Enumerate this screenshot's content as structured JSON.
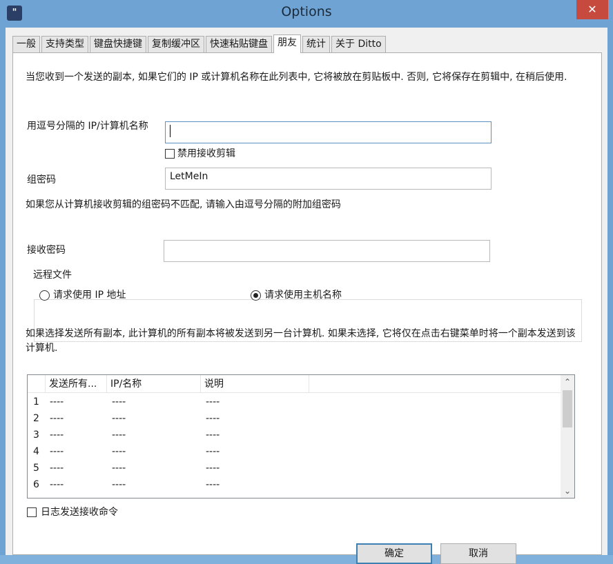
{
  "window": {
    "title": "Options",
    "icon": "ditto-app-icon",
    "close_glyph": "✕"
  },
  "tabs": [
    {
      "label": "一般",
      "active": false
    },
    {
      "label": "支持类型",
      "active": false
    },
    {
      "label": "键盘快捷键",
      "active": false
    },
    {
      "label": "复制缓冲区",
      "active": false
    },
    {
      "label": "快速粘贴键盘",
      "active": false
    },
    {
      "label": "朋友",
      "active": true
    },
    {
      "label": "统计",
      "active": false
    },
    {
      "label": "关于 Ditto",
      "active": false
    }
  ],
  "friends": {
    "intro": "当您收到一个发送的副本, 如果它们的 IP 或计算机名称在此列表中, 它将被放在剪贴板中. 否则, 它将保存在剪辑中, 在稍后使用.",
    "ip_label": "用逗号分隔的 IP/计算机名称",
    "ip_value": "",
    "disable_receive_label": "禁用接收剪辑",
    "disable_receive_checked": false,
    "group_password_label": "组密码",
    "group_password_value": "LetMeIn",
    "extra_password_note": "如果您从计算机接收剪辑的组密码不匹配, 请输入由逗号分隔的附加组密码",
    "receive_password_label": "接收密码",
    "receive_password_value": "",
    "remote_files": {
      "title": "远程文件",
      "option_ip": "请求使用 IP 地址",
      "option_host": "请求使用主机名称",
      "selected": "host"
    },
    "send_all_note": "如果选择发送所有副本, 此计算机的所有副本将被发送到另一台计算机. 如果未选择, 它将仅在点击右键菜单时将一个副本发送到该计算机.",
    "table": {
      "columns": [
        "发送所有...",
        "IP/名称",
        "说明"
      ],
      "rows": [
        {
          "num": "1",
          "send_all": "----",
          "ip": "----",
          "desc": "----"
        },
        {
          "num": "2",
          "send_all": "----",
          "ip": "----",
          "desc": "----"
        },
        {
          "num": "3",
          "send_all": "----",
          "ip": "----",
          "desc": "----"
        },
        {
          "num": "4",
          "send_all": "----",
          "ip": "----",
          "desc": "----"
        },
        {
          "num": "5",
          "send_all": "----",
          "ip": "----",
          "desc": "----"
        },
        {
          "num": "6",
          "send_all": "----",
          "ip": "----",
          "desc": "----"
        }
      ]
    },
    "log_label": "日志发送接收命令",
    "log_checked": false
  },
  "buttons": {
    "ok": "确定",
    "cancel": "取消"
  }
}
